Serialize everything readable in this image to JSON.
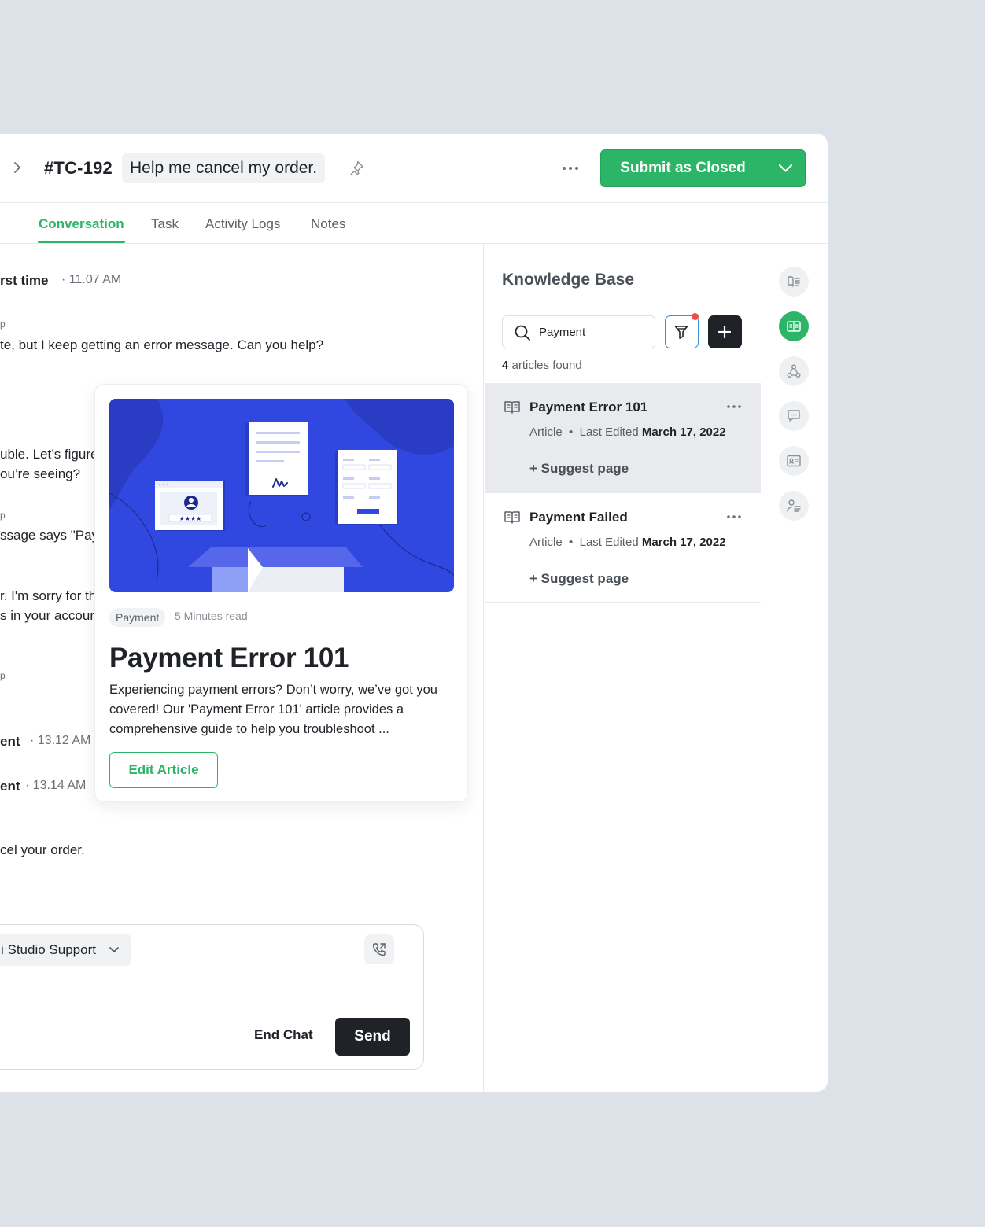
{
  "header": {
    "ticket_id": "#TC-192",
    "ticket_title": "Help me cancel my order.",
    "submit_label": "Submit as Closed"
  },
  "tabs": [
    {
      "label": "Conversation",
      "active": true
    },
    {
      "label": "Task",
      "active": false
    },
    {
      "label": "Activity Logs",
      "active": false
    },
    {
      "label": "Notes",
      "active": false
    }
  ],
  "conversation": {
    "m1_header": "rst time",
    "m1_time": "· 11.07 AM",
    "m1_tiny": "p",
    "m1_text": "te, but I keep getting an error message. Can you help?",
    "m2_line1": "uble. Let’s figure",
    "m2_line2": "ou’re seeing?",
    "m3_tiny": "p",
    "m3_text": "ssage says \"Pay",
    "m4_line1": "r. I'm sorry for th",
    "m4_line2": "s in your accour",
    "m5_tiny": "p",
    "m6_header": "ent",
    "m6_time": "· 13.12 AM",
    "m7_header": "ent",
    "m7_time": "· 13.14 AM",
    "m8_text": "cel your order."
  },
  "composer": {
    "agent": "i Studio Support",
    "end_chat": "End Chat",
    "send": "Send"
  },
  "article_card": {
    "tag": "Payment",
    "read_time": "5 Minutes read",
    "title": "Payment Error 101",
    "body": "Experiencing payment errors? Don’t worry, we’ve got you covered! Our 'Payment Error 101' article provides a comprehensive guide to help you troubleshoot ...",
    "edit_label": "Edit Article"
  },
  "knowledge_base": {
    "title": "Knowledge Base",
    "search_value": "Payment",
    "count_number": "4",
    "count_label": " articles found",
    "items": [
      {
        "title": "Payment Error 101",
        "type": "Article",
        "edited_label": "Last Edited",
        "edited_date": "March 17, 2022",
        "suggest": "+ Suggest page"
      },
      {
        "title": "Payment Failed",
        "type": "Article",
        "edited_label": "Last Edited",
        "edited_date": "March 17, 2022",
        "suggest": "+ Suggest page"
      }
    ]
  },
  "colors": {
    "accent": "#2db567",
    "dark": "#1f2328",
    "illustration_blue": "#3148e0",
    "notification": "#ef4c4c"
  },
  "icons": [
    "chevron-right-icon",
    "pin-icon",
    "more-horizontal-icon",
    "chevron-down-icon",
    "search-icon",
    "filter-icon",
    "plus-icon",
    "book-icon",
    "phone-icon",
    "guide-icon",
    "knowledge-icon",
    "flow-icon",
    "chat-icon",
    "contact-card-icon",
    "user-list-icon"
  ]
}
